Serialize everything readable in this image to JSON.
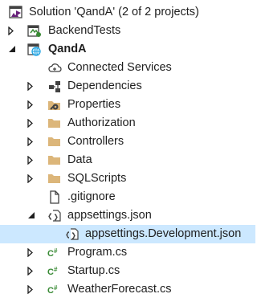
{
  "solution": {
    "label": "Solution 'QandA' (2 of 2 projects)",
    "icon": "solution-icon"
  },
  "projects": [
    {
      "label": "BackendTests",
      "icon": "test-project-icon",
      "expanded": false
    },
    {
      "label": "QandA",
      "icon": "web-project-icon",
      "expanded": true
    }
  ],
  "items": [
    {
      "label": "Connected Services",
      "icon": "cloud-icon"
    },
    {
      "label": "Dependencies",
      "icon": "dependencies-icon"
    },
    {
      "label": "Properties",
      "icon": "properties-icon"
    },
    {
      "label": "Authorization",
      "icon": "folder-icon"
    },
    {
      "label": "Controllers",
      "icon": "folder-icon"
    },
    {
      "label": "Data",
      "icon": "folder-icon"
    },
    {
      "label": "SQLScripts",
      "icon": "folder-icon"
    },
    {
      "label": ".gitignore",
      "icon": "file-icon"
    },
    {
      "label": "appsettings.json",
      "icon": "json-icon",
      "expanded": true
    },
    {
      "label": "appsettings.Development.json",
      "icon": "json-icon",
      "selected": true
    },
    {
      "label": "Program.cs",
      "icon": "csharp-icon"
    },
    {
      "label": "Startup.cs",
      "icon": "csharp-icon"
    },
    {
      "label": "WeatherForecast.cs",
      "icon": "csharp-icon"
    }
  ],
  "colors": {
    "selection": "#cce8ff",
    "folder": "#dcb67a",
    "csharp": "#388a34",
    "vs_purple": "#68217a"
  }
}
